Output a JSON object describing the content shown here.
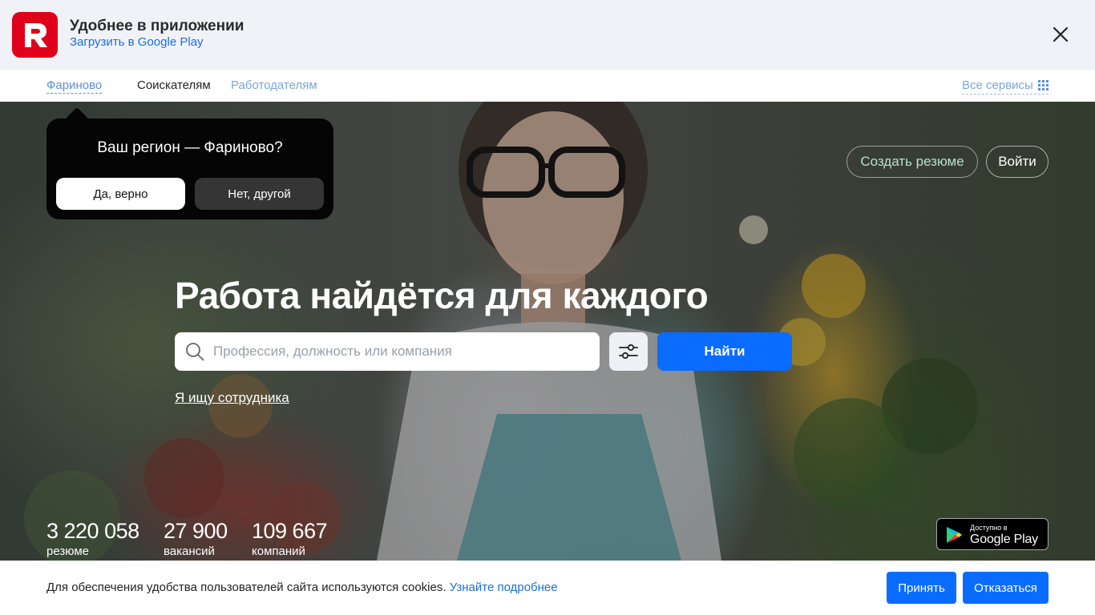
{
  "app_banner": {
    "title": "Удобнее в приложении",
    "link": "Загрузить в Google Play",
    "logo_icon": "rabota-r-logo",
    "close_icon": "close-icon"
  },
  "nav": {
    "region": "Фариново",
    "seekers": "Соискателям",
    "employers": "Работодателям",
    "all_services": "Все сервисы"
  },
  "region_popover": {
    "question": "Ваш регион — Фариново?",
    "yes": "Да, верно",
    "no": "Нет, другой"
  },
  "auth": {
    "create_resume": "Создать резюме",
    "login": "Войти"
  },
  "hero": {
    "headline": "Работа найдётся для каждого",
    "search_placeholder": "Профессия, должность или компания",
    "find": "Найти",
    "employer_link": "Я ищу сотрудника"
  },
  "stats": [
    {
      "value": "3 220 058",
      "label": "резюме"
    },
    {
      "value": "27 900",
      "label": "вакансий"
    },
    {
      "value": "109 667",
      "label": "компаний"
    }
  ],
  "gplay": {
    "small": "Доступно в",
    "big": "Google Play"
  },
  "cookie": {
    "text": "Для обеспечения удобства пользователей сайта используются cookies.",
    "more": "Узнайте подробнее",
    "accept": "Принять",
    "decline": "Отказаться"
  },
  "colors": {
    "brand_red": "#e0001b",
    "primary_blue": "#0a6cff",
    "link_blue": "#1a6fd6"
  }
}
